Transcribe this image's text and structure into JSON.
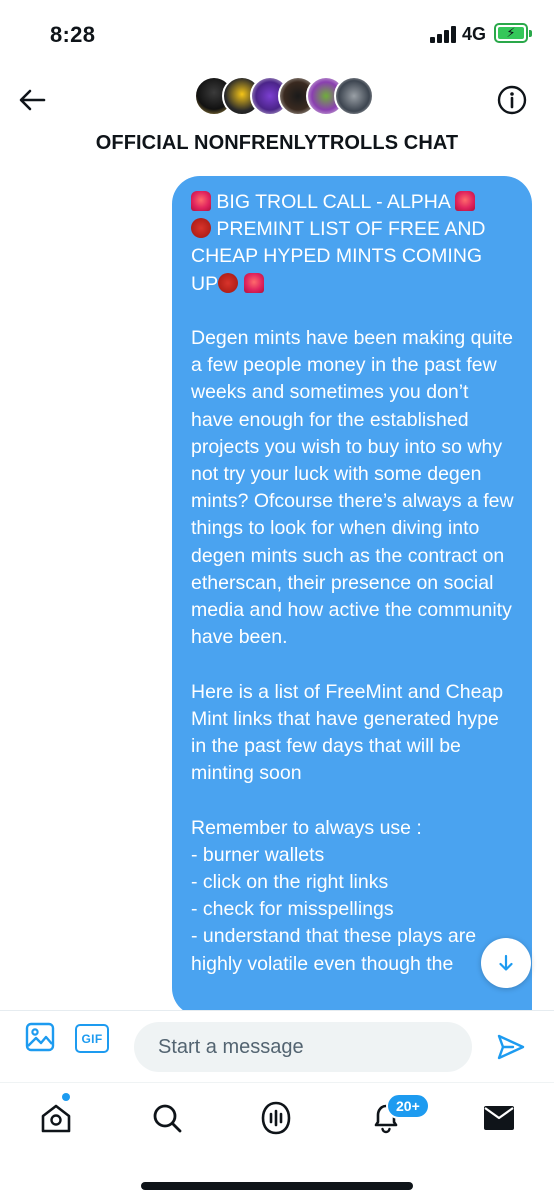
{
  "status_bar": {
    "time": "8:28",
    "network": "4G",
    "signal_icon": "cellular-signal-icon",
    "battery_icon": "battery-charging-icon"
  },
  "header": {
    "back_icon": "arrow-left-icon",
    "info_icon": "info-icon",
    "title": "OFFICIAL NONFRENLYTROLLS CHAT",
    "avatar_count": 6
  },
  "message": {
    "headline_parts": [
      "BIG TROLL CALL - ALPHA ",
      " PREMINT LIST OF FREE AND CHEAP HYPED MINTS COMING UP"
    ],
    "paragraph_1": "Degen mints have been making quite a few people money in the past few weeks and sometimes you don’t have enough for the established projects you wish to buy into so why not try your luck with some degen mints? Ofcourse there’s always a few things to look for when diving into degen mints such as the contract on etherscan, their presence on social media and how active the community have been.",
    "paragraph_2": "Here is a list of FreeMint and Cheap Mint links that have generated hype in the past few days that will be minting soon",
    "paragraph_3": "Remember to always use :\n- burner wallets\n- click on the right links\n- check for misspellings\n- understand that these plays are highly volatile even though the",
    "emoji_icons": [
      "rotating-light-icon",
      "japanese-ogre-icon"
    ]
  },
  "scroll_down_icon": "arrow-down-icon",
  "composer": {
    "placeholder": "Start a message",
    "media_icon": "image-icon",
    "gif_label": "GIF",
    "send_icon": "send-icon"
  },
  "tabbar": {
    "home_icon": "home-icon",
    "search_icon": "search-icon",
    "spaces_icon": "spaces-icon",
    "notifications_icon": "bell-icon",
    "notifications_badge": "20+",
    "messages_icon": "mail-icon"
  },
  "colors": {
    "bubble": "#4aa3f0",
    "accent": "#1d9bf0",
    "battery": "#34c759"
  }
}
